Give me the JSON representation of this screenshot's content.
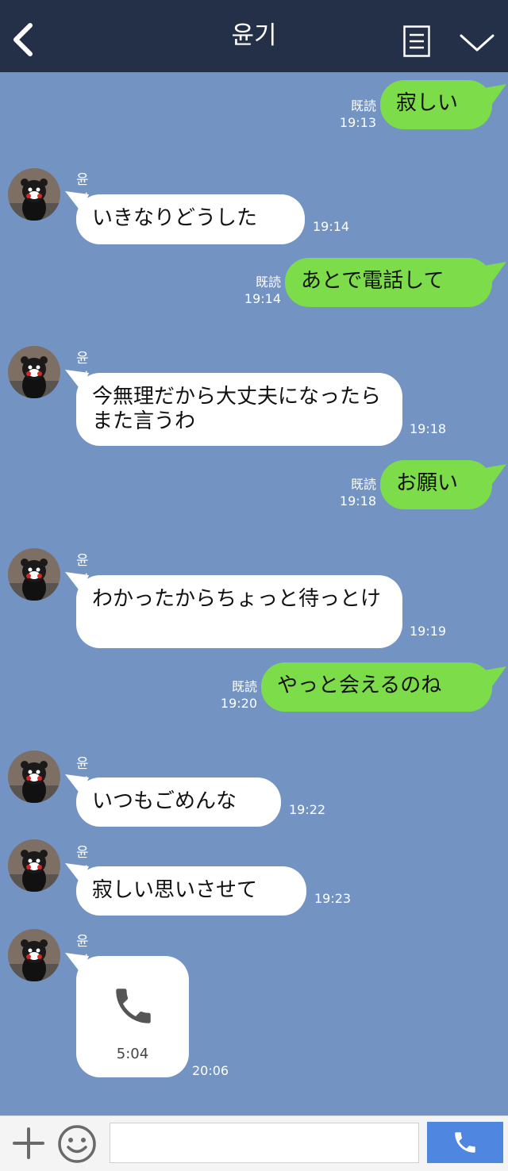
{
  "header": {
    "title": "윤기"
  },
  "messages": [
    {
      "dir": "out",
      "text": "寂しい",
      "read": "既読",
      "time": "19:13"
    },
    {
      "dir": "in",
      "sender": "윤기",
      "text": "いきなりどうした",
      "time": "19:14"
    },
    {
      "dir": "out",
      "text": "あとで電話して",
      "read": "既読",
      "time": "19:14"
    },
    {
      "dir": "in",
      "sender": "윤기",
      "text": "今無理だから大丈夫になったらまた言うわ",
      "time": "19:18"
    },
    {
      "dir": "out",
      "text": "お願い",
      "read": "既読",
      "time": "19:18"
    },
    {
      "dir": "in",
      "sender": "윤기",
      "text": "わかったからちょっと待っとけ",
      "time": "19:19"
    },
    {
      "dir": "out",
      "text": "やっと会えるのね",
      "read": "既読",
      "time": "19:20"
    },
    {
      "dir": "in",
      "sender": "윤기",
      "text": "いつもごめんな",
      "time": "19:22"
    },
    {
      "dir": "in",
      "sender": "윤기",
      "text": "寂しい思いさせて",
      "time": "19:23"
    },
    {
      "dir": "in",
      "sender": "윤기",
      "call": {
        "icon": "phone-icon",
        "duration": "5:04"
      },
      "time": "20:06"
    }
  ],
  "footer": {
    "input_placeholder": "",
    "icons": [
      "plus-icon",
      "emoji-icon",
      "phone-icon"
    ]
  },
  "colors": {
    "header_bg": "#243048",
    "chat_bg": "#7393c3",
    "outgoing_bubble": "#7cdc4a",
    "incoming_bubble": "#ffffff",
    "send_button": "#4f86df"
  }
}
